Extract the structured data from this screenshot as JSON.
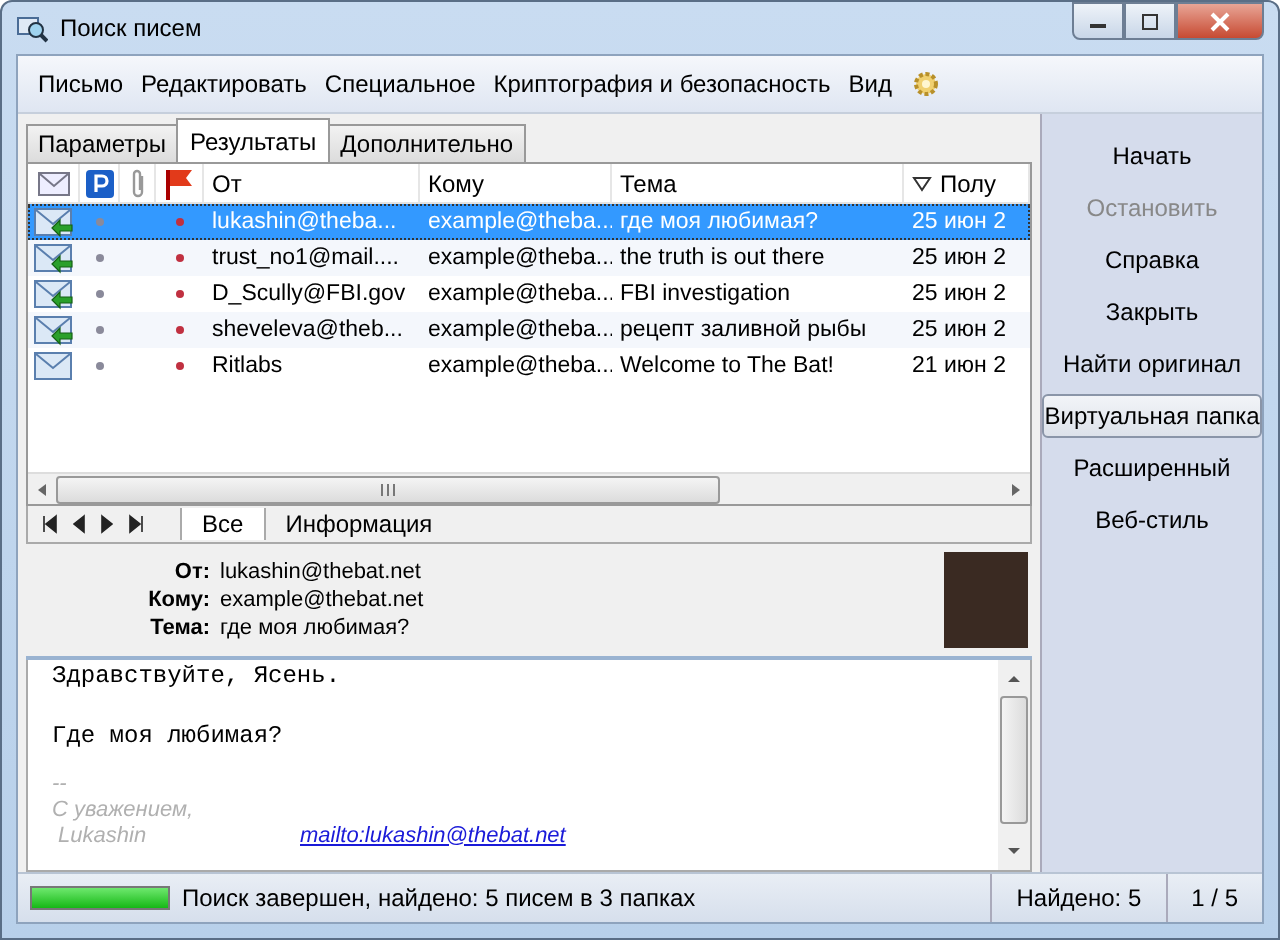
{
  "window": {
    "title": "Поиск писем"
  },
  "menu": [
    {
      "label": "Письмо"
    },
    {
      "label": "Редактировать"
    },
    {
      "label": "Специальное"
    },
    {
      "label": "Криптография и безопасность"
    },
    {
      "label": "Вид"
    }
  ],
  "tabs": [
    {
      "label": "Параметры",
      "selected": false
    },
    {
      "label": "Результаты",
      "selected": true
    },
    {
      "label": "Дополнительно",
      "selected": false
    }
  ],
  "table": {
    "columns": [
      "От",
      "Кому",
      "Тема",
      "Полу"
    ],
    "rows": [
      {
        "from": "lukashin@theba...",
        "to": "example@theba...",
        "subject": "где моя любимая?",
        "date": "25 июн 2",
        "replied": true,
        "selected": true
      },
      {
        "from": "trust_no1@mail....",
        "to": "example@theba...",
        "subject": "the truth is out there",
        "date": "25 июн 2",
        "replied": true,
        "selected": false
      },
      {
        "from": "D_Scully@FBI.gov",
        "to": "example@theba...",
        "subject": "FBI investigation",
        "date": "25 июн 2",
        "replied": true,
        "selected": false
      },
      {
        "from": "sheveleva@theb...",
        "to": "example@theba...",
        "subject": "рецепт заливной рыбы",
        "date": "25 июн 2",
        "replied": true,
        "selected": false
      },
      {
        "from": "Ritlabs",
        "to": "example@theba...",
        "subject": "Welcome to The Bat!",
        "date": "21 июн 2",
        "replied": false,
        "selected": false
      }
    ]
  },
  "view_tabs": [
    {
      "label": "Все",
      "selected": true
    },
    {
      "label": "Информация",
      "selected": false
    }
  ],
  "headers": [
    {
      "label": "От:",
      "value": "lukashin@thebat.net"
    },
    {
      "label": "Кому:",
      "value": "example@thebat.net"
    },
    {
      "label": "Тема:",
      "value": "где моя любимая?"
    }
  ],
  "body": {
    "lines": [
      "Здравствуйте, Ясень.",
      "Где моя любимая?"
    ],
    "signature": [
      "--",
      "С уважением,",
      " Lukashin"
    ],
    "link": "mailto:lukashin@thebat.net"
  },
  "sidebar": [
    {
      "label": "Начать",
      "disabled": false,
      "hovered": false
    },
    {
      "label": "Остановить",
      "disabled": true,
      "hovered": false
    },
    {
      "label": "Справка",
      "disabled": false,
      "hovered": false
    },
    {
      "label": "Закрыть",
      "disabled": false,
      "hovered": false
    },
    {
      "label": "Найти оригинал",
      "disabled": false,
      "hovered": false
    },
    {
      "label": "Виртуальная папка",
      "disabled": false,
      "hovered": true
    },
    {
      "label": "Расширенный",
      "disabled": false,
      "hovered": false
    },
    {
      "label": "Веб-стиль",
      "disabled": false,
      "hovered": false
    }
  ],
  "status_bar": {
    "level": 1,
    "text": "Поиск завершен, найдено: 5 писем в 3 папках",
    "found": "Найдено: 5",
    "position": "1 / 5"
  }
}
